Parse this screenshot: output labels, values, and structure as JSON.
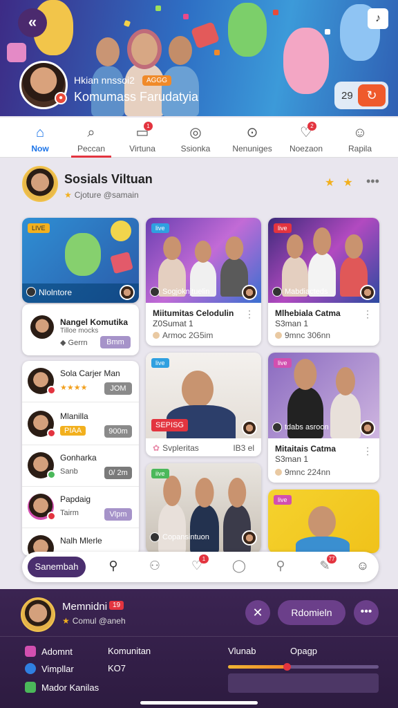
{
  "hero": {
    "line1": "Hkian nnssoi2",
    "badge": "AGGG",
    "line2": "Komumass Farudatyia",
    "count": "29",
    "back_icon": "back-chevron-icon",
    "music_icon": "music-note-icon",
    "share_icon": "share-icon"
  },
  "nav": {
    "items": [
      {
        "label": "Now",
        "icon": "home-icon"
      },
      {
        "label": "Peccan",
        "icon": "search-icon"
      },
      {
        "label": "Virtuna",
        "icon": "chat-icon",
        "badge": "1"
      },
      {
        "label": "Ssionka",
        "icon": "explore-icon"
      },
      {
        "label": "Nenuniges",
        "icon": "magnify-icon"
      },
      {
        "label": "Noezaon",
        "icon": "heart-icon",
        "badge": "2"
      },
      {
        "label": "Rapila",
        "icon": "profile-icon"
      }
    ]
  },
  "header": {
    "title": "Sosials Viltuan",
    "subtitle": "Cjoture @samain"
  },
  "cards": {
    "c1": {
      "tag": "LIVE",
      "caption": "Nlolntore"
    },
    "c1info": {
      "title": "Nangel Komutika",
      "sub": "Tilloe mocks",
      "meta": "Gerrn",
      "pill": "Bmm"
    },
    "c2": {
      "tag": "live",
      "caption": "Sogjoknjtuelin",
      "title": "Miitumitas Celodulin",
      "sub": "Z0Sumat 1",
      "meta": "Armoc 2G5im"
    },
    "c3": {
      "tag": "live",
      "caption": "Mabdiacteds",
      "title": "Mlhebiala Catma",
      "sub": "S3man 1",
      "meta": "9mnc 306nn"
    },
    "c4": {
      "tag": "live",
      "label": "SEPISG",
      "meta": "Svpleritas",
      "value": "IB3 el"
    },
    "c5": {
      "tag": "live",
      "caption": "tdabs asroon",
      "title": "Mitaitais Catma",
      "sub": "S3man 1",
      "meta": "9mnc 224nn"
    },
    "c6": {
      "tag": "iive",
      "caption": "Copansintuon"
    },
    "c7": {
      "tag": "live"
    }
  },
  "list": {
    "items": [
      {
        "name": "Sola Carjer Man",
        "sub": "★★★★",
        "pill": "JOM"
      },
      {
        "name": "Mlanilla",
        "sub": "PIAA",
        "pill": "900m"
      },
      {
        "name": "Gonharka",
        "sub": "Sanb",
        "pill": "0/ 2m"
      },
      {
        "name": "Papdaig",
        "sub": "Tairm",
        "pill": "Vlpm"
      },
      {
        "name": "Nalh Mlerle",
        "sub": "★★★★★",
        "pill": ""
      }
    ]
  },
  "toolbar": {
    "home_label": "Sanembah",
    "icons": [
      "person-icon",
      "people-icon",
      "heart-icon",
      "chat-bubble-icon",
      "user-icon",
      "edit-icon",
      "emoji-icon"
    ],
    "badge1": "1",
    "badge2": "77"
  },
  "footer": {
    "name": "Memnidni",
    "badge": "19",
    "subtitle": "Comul @aneh",
    "action_label": "Rdomieln",
    "rows": [
      "Adomnt",
      "Vimpllar",
      "Mador Kanilas"
    ],
    "col2": [
      "Komunitan",
      "KO7"
    ],
    "label1": "Vlunab",
    "label2": "Opagp",
    "progress": 0.39,
    "colors": {
      "accent": "#6b3f8a",
      "progress": "#f0b533",
      "badge": "#e3343f"
    }
  }
}
